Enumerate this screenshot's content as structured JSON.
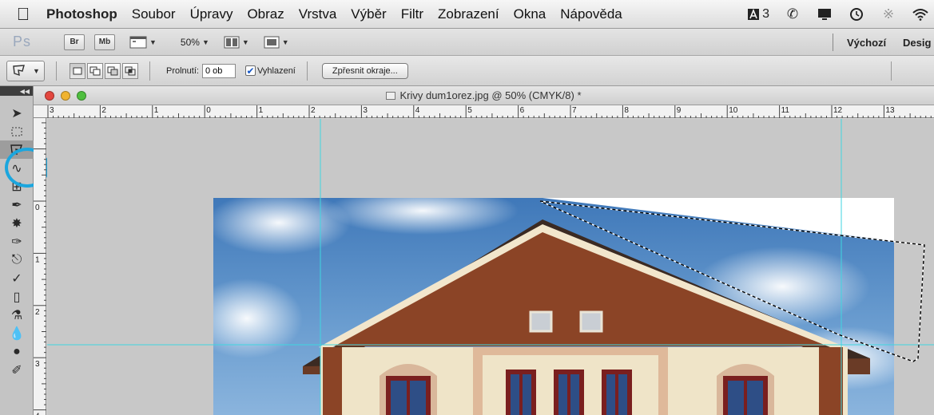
{
  "menubar": {
    "app_name": "Photoshop",
    "items": [
      "Soubor",
      "Úpravy",
      "Obraz",
      "Vrstva",
      "Výběr",
      "Filtr",
      "Zobrazení",
      "Okna",
      "Nápověda"
    ],
    "status": "3",
    "icons": [
      "apple-icon",
      "adobe-icon",
      "phone-icon",
      "display-icon",
      "time-machine-icon",
      "bluetooth-icon",
      "wifi-icon"
    ]
  },
  "appbar": {
    "ps_logo": "Ps",
    "bridge_label": "Br",
    "minibridge_label": "Mb",
    "zoom_value": "50%",
    "workspace_default": "Výchozí",
    "workspace_design": "Desig"
  },
  "options": {
    "feather_label": "Prolnutí:",
    "feather_value": "0 ob",
    "antialias_label": "Vyhlazení",
    "antialias_checked": true,
    "refine_label": "Zpřesnit okraje..."
  },
  "document": {
    "title": "Krivy dum1orez.jpg @ 50% (CMYK/8) *"
  },
  "ruler": {
    "h_labels": [
      "3",
      "2",
      "1",
      "0",
      "1",
      "2",
      "3",
      "4",
      "5",
      "6",
      "7",
      "8",
      "9",
      "10",
      "11",
      "12",
      "13"
    ],
    "v_labels": [
      "0",
      "1",
      "2",
      "3",
      "4"
    ]
  },
  "toolbox": {
    "tools": [
      "move-tool-icon",
      "marquee-tool-icon",
      "lasso-tool-icon",
      "quick-selection-tool-icon",
      "crop-tool-icon",
      "eyedropper-tool-icon",
      "healing-brush-tool-icon",
      "brush-tool-icon",
      "clone-stamp-tool-icon",
      "history-brush-tool-icon",
      "eraser-tool-icon",
      "paint-bucket-tool-icon",
      "blur-tool-icon",
      "dodge-tool-icon",
      "pen-tool-icon"
    ],
    "selected": "lasso-tool-icon"
  },
  "colors": {
    "guide": "#3fd6e0",
    "highlight": "#1ba6de",
    "roof": "#8b4426",
    "wall": "#efe4c8"
  }
}
